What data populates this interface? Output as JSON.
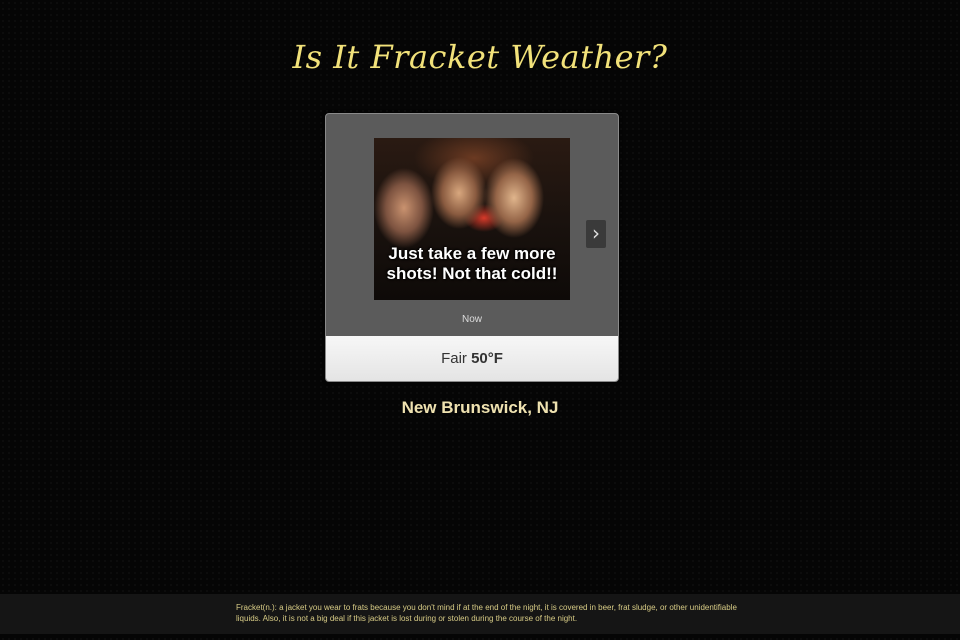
{
  "header": {
    "title": "Is It Fracket Weather?"
  },
  "weather_widget": {
    "photo_caption": "Just take a few more shots! Not that cold!!",
    "next_icon": "chevron-right-icon",
    "next_glyph": "›",
    "time_label": "Now",
    "condition": "Fair",
    "temperature": "50°F"
  },
  "location": {
    "name": "New Brunswick, NJ"
  },
  "footer": {
    "definition": "Fracket(n.): a jacket you wear to frats because you don't mind if at the end of the night, it is covered in beer, frat sludge, or other unidentifiable liquids. Also, it is not a big deal if this jacket is lost during or stolen during the course of the night."
  },
  "colors": {
    "title": "#f2e27a",
    "location": "#efe2b0",
    "footer_text": "#d8cc86",
    "widget_bg": "#5b5b5b"
  }
}
